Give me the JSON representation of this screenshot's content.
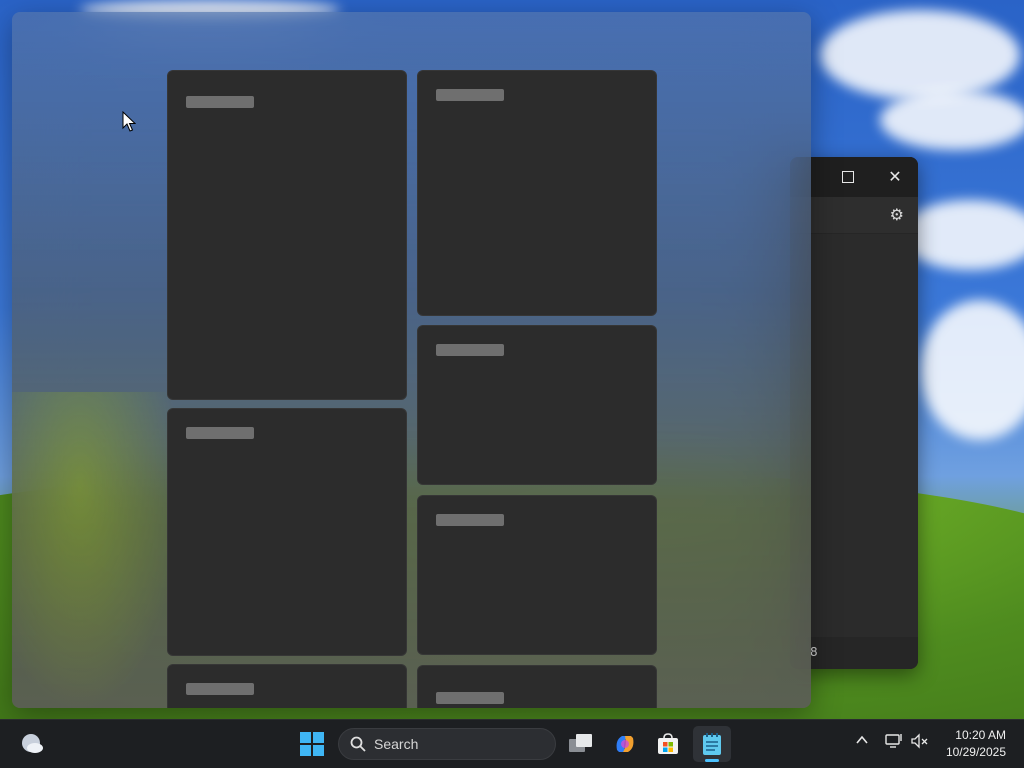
{
  "taskbar": {
    "search_label": "Search",
    "time": "10:20 AM",
    "date": "10/29/2025",
    "accent_color": "#4cc2ff",
    "items": [
      {
        "name": "widgets-weather-icon"
      },
      {
        "name": "start-windows-icon"
      },
      {
        "name": "task-view-icon"
      },
      {
        "name": "copilot-icon"
      },
      {
        "name": "microsoft-store-icon"
      },
      {
        "name": "notepad-icon"
      }
    ]
  },
  "background_window": {
    "status_text": "8"
  },
  "widgets_panel": {
    "card_count": 8,
    "card_titles": [
      "",
      "",
      "",
      "",
      "",
      "",
      "",
      ""
    ]
  }
}
